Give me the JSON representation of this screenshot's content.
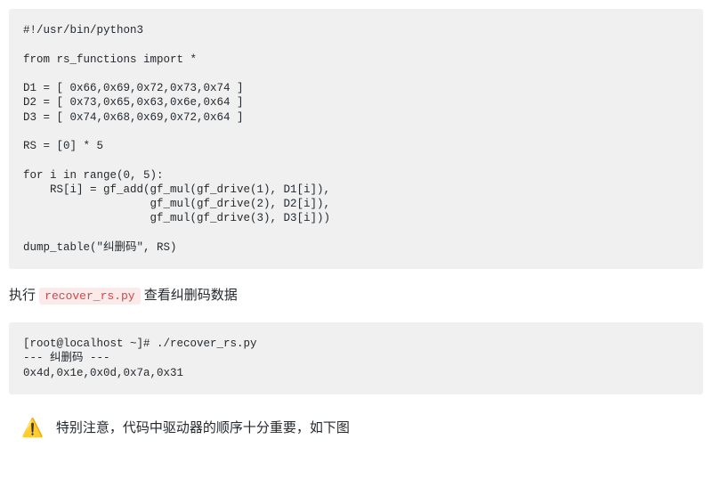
{
  "code1": "#!/usr/bin/python3\n\nfrom rs_functions import *\n\nD1 = [ 0x66,0x69,0x72,0x73,0x74 ]\nD2 = [ 0x73,0x65,0x63,0x6e,0x64 ]\nD3 = [ 0x74,0x68,0x69,0x72,0x64 ]\n\nRS = [0] * 5\n\nfor i in range(0, 5):\n    RS[i] = gf_add(gf_mul(gf_drive(1), D1[i]),\n                   gf_mul(gf_drive(2), D2[i]),\n                   gf_mul(gf_drive(3), D3[i]))\n\ndump_table(\"纠删码\", RS)",
  "para1": {
    "prefix": "执行 ",
    "code": "recover_rs.py",
    "suffix": " 查看纠删码数据"
  },
  "code2": "[root@localhost ~]# ./recover_rs.py\n--- 纠删码 ---\n0x4d,0x1e,0x0d,0x7a,0x31",
  "alert": {
    "icon": "⚠️",
    "text": "特别注意，代码中驱动器的顺序十分重要，如下图"
  }
}
